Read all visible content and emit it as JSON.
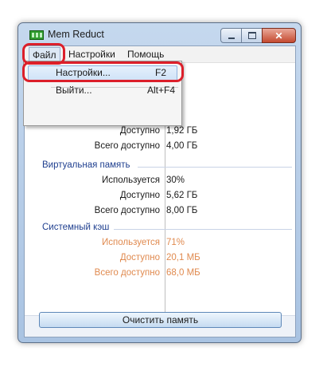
{
  "window": {
    "title": "Mem Reduct",
    "close_glyph": "✕"
  },
  "menubar": {
    "items": [
      "Файл",
      "Настройки",
      "Помощь"
    ]
  },
  "file_menu": [
    {
      "label": "Настройки...",
      "shortcut": "F2"
    },
    {
      "label": "Выйти...",
      "shortcut": "Alt+F4"
    }
  ],
  "physical_memory": {
    "rows": [
      {
        "label": "Доступно",
        "value": "1,92 ГБ"
      },
      {
        "label": "Всего доступно",
        "value": "4,00 ГБ"
      }
    ]
  },
  "virtual_memory": {
    "title": "Виртуальная память",
    "rows": [
      {
        "label": "Используется",
        "value": "30%"
      },
      {
        "label": "Доступно",
        "value": "5,62 ГБ"
      },
      {
        "label": "Всего доступно",
        "value": "8,00 ГБ"
      }
    ]
  },
  "system_cache": {
    "title": "Системный кэш",
    "rows": [
      {
        "label": "Используется",
        "value": "71%"
      },
      {
        "label": "Доступно",
        "value": "20,1 МБ"
      },
      {
        "label": "Всего доступно",
        "value": "68,0 МБ"
      }
    ]
  },
  "clean_button": "Очистить память",
  "colors": {
    "highlight": "#dc1f2a",
    "section_title": "#1f3f8f",
    "cache_text": "#e08a4f"
  }
}
